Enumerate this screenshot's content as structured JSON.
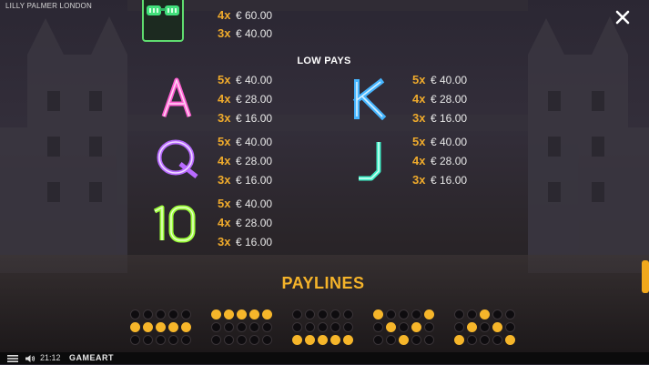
{
  "header": {
    "title": "LILLY PALMER LONDON"
  },
  "sections": {
    "low_pays": "LOW PAYS",
    "paylines": "PAYLINES"
  },
  "top_partial": [
    {
      "mult": "4x",
      "value": "€ 60.00"
    },
    {
      "mult": "3x",
      "value": "€ 40.00"
    }
  ],
  "low_pays": [
    {
      "symbol": "A",
      "rows": [
        {
          "mult": "5x",
          "value": "€ 40.00"
        },
        {
          "mult": "4x",
          "value": "€ 28.00"
        },
        {
          "mult": "3x",
          "value": "€ 16.00"
        }
      ]
    },
    {
      "symbol": "K",
      "rows": [
        {
          "mult": "5x",
          "value": "€ 40.00"
        },
        {
          "mult": "4x",
          "value": "€ 28.00"
        },
        {
          "mult": "3x",
          "value": "€ 16.00"
        }
      ]
    },
    {
      "symbol": "Q",
      "rows": [
        {
          "mult": "5x",
          "value": "€ 40.00"
        },
        {
          "mult": "4x",
          "value": "€ 28.00"
        },
        {
          "mult": "3x",
          "value": "€ 16.00"
        }
      ]
    },
    {
      "symbol": "J",
      "rows": [
        {
          "mult": "5x",
          "value": "€ 40.00"
        },
        {
          "mult": "4x",
          "value": "€ 28.00"
        },
        {
          "mult": "3x",
          "value": "€ 16.00"
        }
      ]
    },
    {
      "symbol": "10",
      "rows": [
        {
          "mult": "5x",
          "value": "€ 40.00"
        },
        {
          "mult": "4x",
          "value": "€ 28.00"
        },
        {
          "mult": "3x",
          "value": "€ 16.00"
        }
      ]
    }
  ],
  "paylines": [
    [
      [
        0,
        0,
        0,
        0,
        0
      ],
      [
        1,
        1,
        1,
        1,
        1
      ],
      [
        0,
        0,
        0,
        0,
        0
      ]
    ],
    [
      [
        1,
        1,
        1,
        1,
        1
      ],
      [
        0,
        0,
        0,
        0,
        0
      ],
      [
        0,
        0,
        0,
        0,
        0
      ]
    ],
    [
      [
        0,
        0,
        0,
        0,
        0
      ],
      [
        0,
        0,
        0,
        0,
        0
      ],
      [
        1,
        1,
        1,
        1,
        1
      ]
    ],
    [
      [
        1,
        0,
        0,
        0,
        1
      ],
      [
        0,
        1,
        0,
        1,
        0
      ],
      [
        0,
        0,
        1,
        0,
        0
      ]
    ],
    [
      [
        0,
        0,
        1,
        0,
        0
      ],
      [
        0,
        1,
        0,
        1,
        0
      ],
      [
        1,
        0,
        0,
        0,
        1
      ]
    ]
  ],
  "footer": {
    "time": "21:12",
    "brand": "GAMEART"
  },
  "colors": {
    "accent": "#f6b62a",
    "mult": "#f0ab2c",
    "A": "#ff5fd2",
    "K": "#5ec8ff",
    "Q": "#b86bff",
    "J": "#3ff0c8",
    "10": "#9dff3a"
  },
  "icons": {
    "close": "close-icon",
    "menu": "menu-icon",
    "sound": "speaker-icon"
  }
}
